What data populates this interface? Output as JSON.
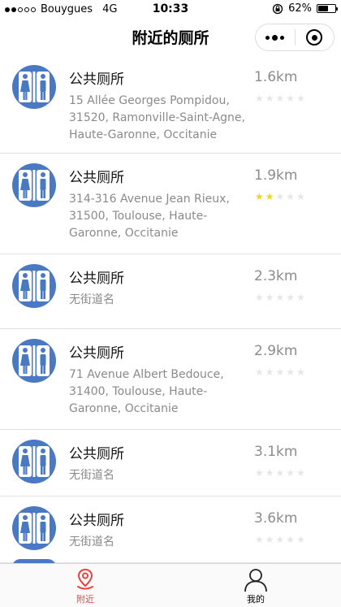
{
  "status_bar": {
    "carrier": "Bouygues",
    "network": "4G",
    "time": "10:33",
    "battery": "62%",
    "battery_level": 0.62,
    "signal_bars_filled": 2,
    "signal_bars_total": 5
  },
  "nav": {
    "title": "附近的厕所"
  },
  "colors": {
    "icon_blue": "#4a79c4",
    "star_on": "#f4d21f",
    "star_off": "#e6e6e6",
    "tab_active": "#e64340"
  },
  "toilets": [
    {
      "name": "公共厕所",
      "address": "15 Allée Georges Pompidou, 31520, Ramonville-Saint-Agne, Haute-Garonne, Occitanie",
      "distance": "1.6km",
      "rating": 0
    },
    {
      "name": "公共厕所",
      "address": "314-316 Avenue Jean Rieux, 31500, Toulouse, Haute-Garonne, Occitanie",
      "distance": "1.9km",
      "rating": 2
    },
    {
      "name": "公共厕所",
      "address": "无街道名",
      "distance": "2.3km",
      "rating": 0
    },
    {
      "name": "公共厕所",
      "address": "71 Avenue Albert Bedouce, 31400, Toulouse, Haute-Garonne, Occitanie",
      "distance": "2.9km",
      "rating": 0
    },
    {
      "name": "公共厕所",
      "address": "无街道名",
      "distance": "3.1km",
      "rating": 0
    },
    {
      "name": "公共厕所",
      "address": "无街道名",
      "distance": "3.6km",
      "rating": 0
    }
  ],
  "tabs": [
    {
      "label": "附近",
      "icon": "location-pin-icon",
      "active": true
    },
    {
      "label": "我的",
      "icon": "person-icon",
      "active": false
    }
  ]
}
